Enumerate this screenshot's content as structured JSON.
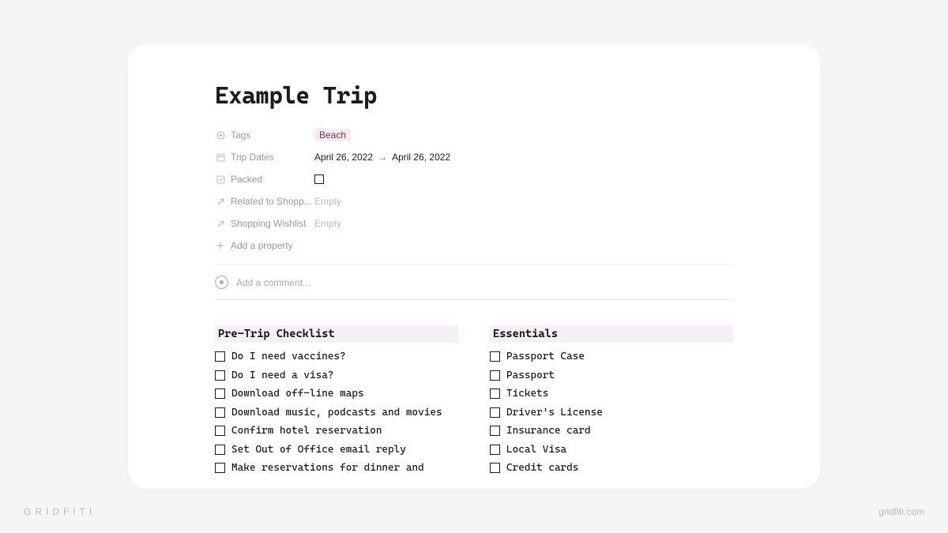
{
  "page": {
    "title": "Example Trip"
  },
  "properties": {
    "tags": {
      "label": "Tags",
      "value": "Beach"
    },
    "dates": {
      "label": "Trip Dates",
      "start": "April 26, 2022",
      "end": "April 26, 2022"
    },
    "packed": {
      "label": "Packed",
      "checked": false
    },
    "related_shopping": {
      "label": "Related to Shopp...",
      "value": "Empty"
    },
    "shopping_wishlist": {
      "label": "Shopping Wishlist",
      "value": "Empty"
    },
    "add_property": "Add a property"
  },
  "comment": {
    "placeholder": "Add a comment..."
  },
  "columns": {
    "left": {
      "heading": "Pre-Trip Checklist",
      "items": [
        "Do I need vaccines?",
        "Do I need a visa?",
        "Download off-line maps",
        "Download music, podcasts and movies",
        "Confirm hotel reservation",
        "Set Out of Office email reply",
        "Make reservations for dinner and"
      ]
    },
    "right": {
      "heading": "Essentials",
      "items": [
        "Passport Case",
        "Passport",
        "Tickets",
        "Driver's License",
        "Insurance card",
        "Local Visa",
        "Credit cards"
      ]
    }
  },
  "watermark": {
    "left": "GRIDFITI",
    "right": "gridfiti.com"
  }
}
